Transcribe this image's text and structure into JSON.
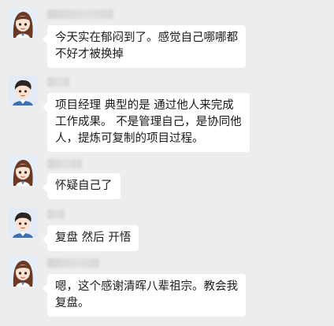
{
  "chat": {
    "messages": [
      {
        "sender": "female",
        "avatar_icon": "girl-avatar-icon",
        "text": "今天实在郁闷到了。感觉自己哪哪都\n不好才被换掉"
      },
      {
        "sender": "male",
        "avatar_icon": "boy-avatar-icon",
        "text": "项目经理  典型的是 通过他人来完成\n工作成果。 不是管理自己，是协同他\n人，提炼可复制的项目过程。"
      },
      {
        "sender": "female",
        "avatar_icon": "girl-avatar-icon",
        "text": "怀疑自己了"
      },
      {
        "sender": "male",
        "avatar_icon": "boy-avatar-icon",
        "text": "复盘  然后 开悟"
      },
      {
        "sender": "female",
        "avatar_icon": "girl-avatar-icon",
        "text": "嗯，这个感谢清晖八辈祖宗。教会我\n复盘。"
      }
    ]
  },
  "colors": {
    "background": "#ededed",
    "bubble": "#ffffff",
    "text": "#1a1a1a"
  }
}
